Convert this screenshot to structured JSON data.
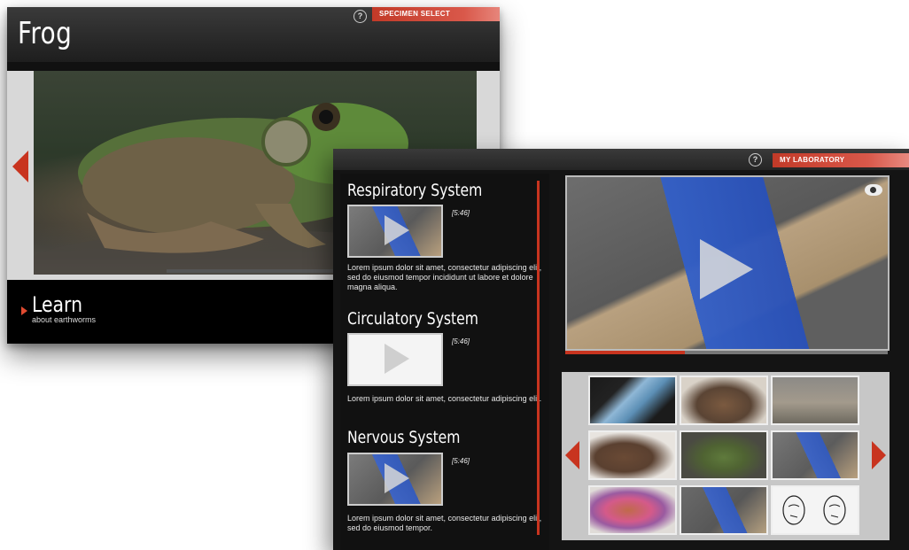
{
  "frog_screen": {
    "title": "Frog",
    "tab_label": "SPECIMEN SELECT",
    "help_icon": "?",
    "learn_label": "Learn",
    "learn_subtitle": "about earthworms",
    "progress": 0.0
  },
  "lab_screen": {
    "tab_label": "MY LABORATORY",
    "help_icon": "?",
    "systems": [
      {
        "title": "Respiratory System",
        "duration": "[5:46]",
        "description": "Lorem ipsum dolor sit amet, consectetur adipiscing elit, sed do eiusmod tempor incididunt ut labore et dolore magna aliqua."
      },
      {
        "title": "Circulatory System",
        "duration": "[5:46]",
        "description": "Lorem ipsum dolor sit amet, consectetur adipiscing elit."
      },
      {
        "title": "Nervous System",
        "duration": "[5:46]",
        "description": "Lorem ipsum dolor sit amet, consectetur adipiscing elit, sed do eiusmod tempor."
      }
    ],
    "video_progress": 0.37
  },
  "colors": {
    "accent_red": "#c8341f",
    "tab_red": "#d9584a"
  }
}
